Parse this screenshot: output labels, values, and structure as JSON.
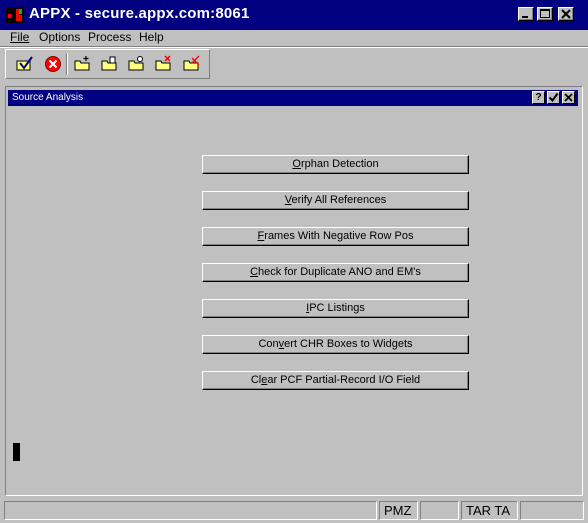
{
  "window": {
    "title": "APPX - secure.appx.com:8061",
    "controls": [
      "minimize-icon",
      "maximize-icon",
      "close-icon"
    ]
  },
  "menu": {
    "items": [
      "File",
      "Options",
      "Process",
      "Help"
    ]
  },
  "toolbar": {
    "icons": [
      "checkmark-folder-icon",
      "cancel-icon",
      "folder-new-icon",
      "folder-edit-icon",
      "folder-search-icon",
      "folder-delete-icon",
      "folder-check-icon"
    ]
  },
  "dialog": {
    "title": "Source Analysis",
    "controls": [
      "help-icon",
      "ok-check-icon",
      "close-icon"
    ]
  },
  "actions": [
    {
      "label_pre": "",
      "label_u": "O",
      "label_post": "rphan Detection"
    },
    {
      "label_pre": "",
      "label_u": "V",
      "label_post": "erify All References"
    },
    {
      "label_pre": "",
      "label_u": "F",
      "label_post": "rames With Negative Row Pos"
    },
    {
      "label_pre": "",
      "label_u": "C",
      "label_post": "heck for Duplicate ANO and EM's"
    },
    {
      "label_pre": "",
      "label_u": "I",
      "label_post": "PC Listings"
    },
    {
      "label_pre": "Con",
      "label_u": "v",
      "label_post": "ert CHR Boxes to Widgets"
    },
    {
      "label_pre": "Cl",
      "label_u": "e",
      "label_post": "ar PCF Partial-Record I/O Field"
    }
  ],
  "status": {
    "cells": [
      "",
      "PMZ",
      "",
      "TAR TA",
      ""
    ]
  }
}
